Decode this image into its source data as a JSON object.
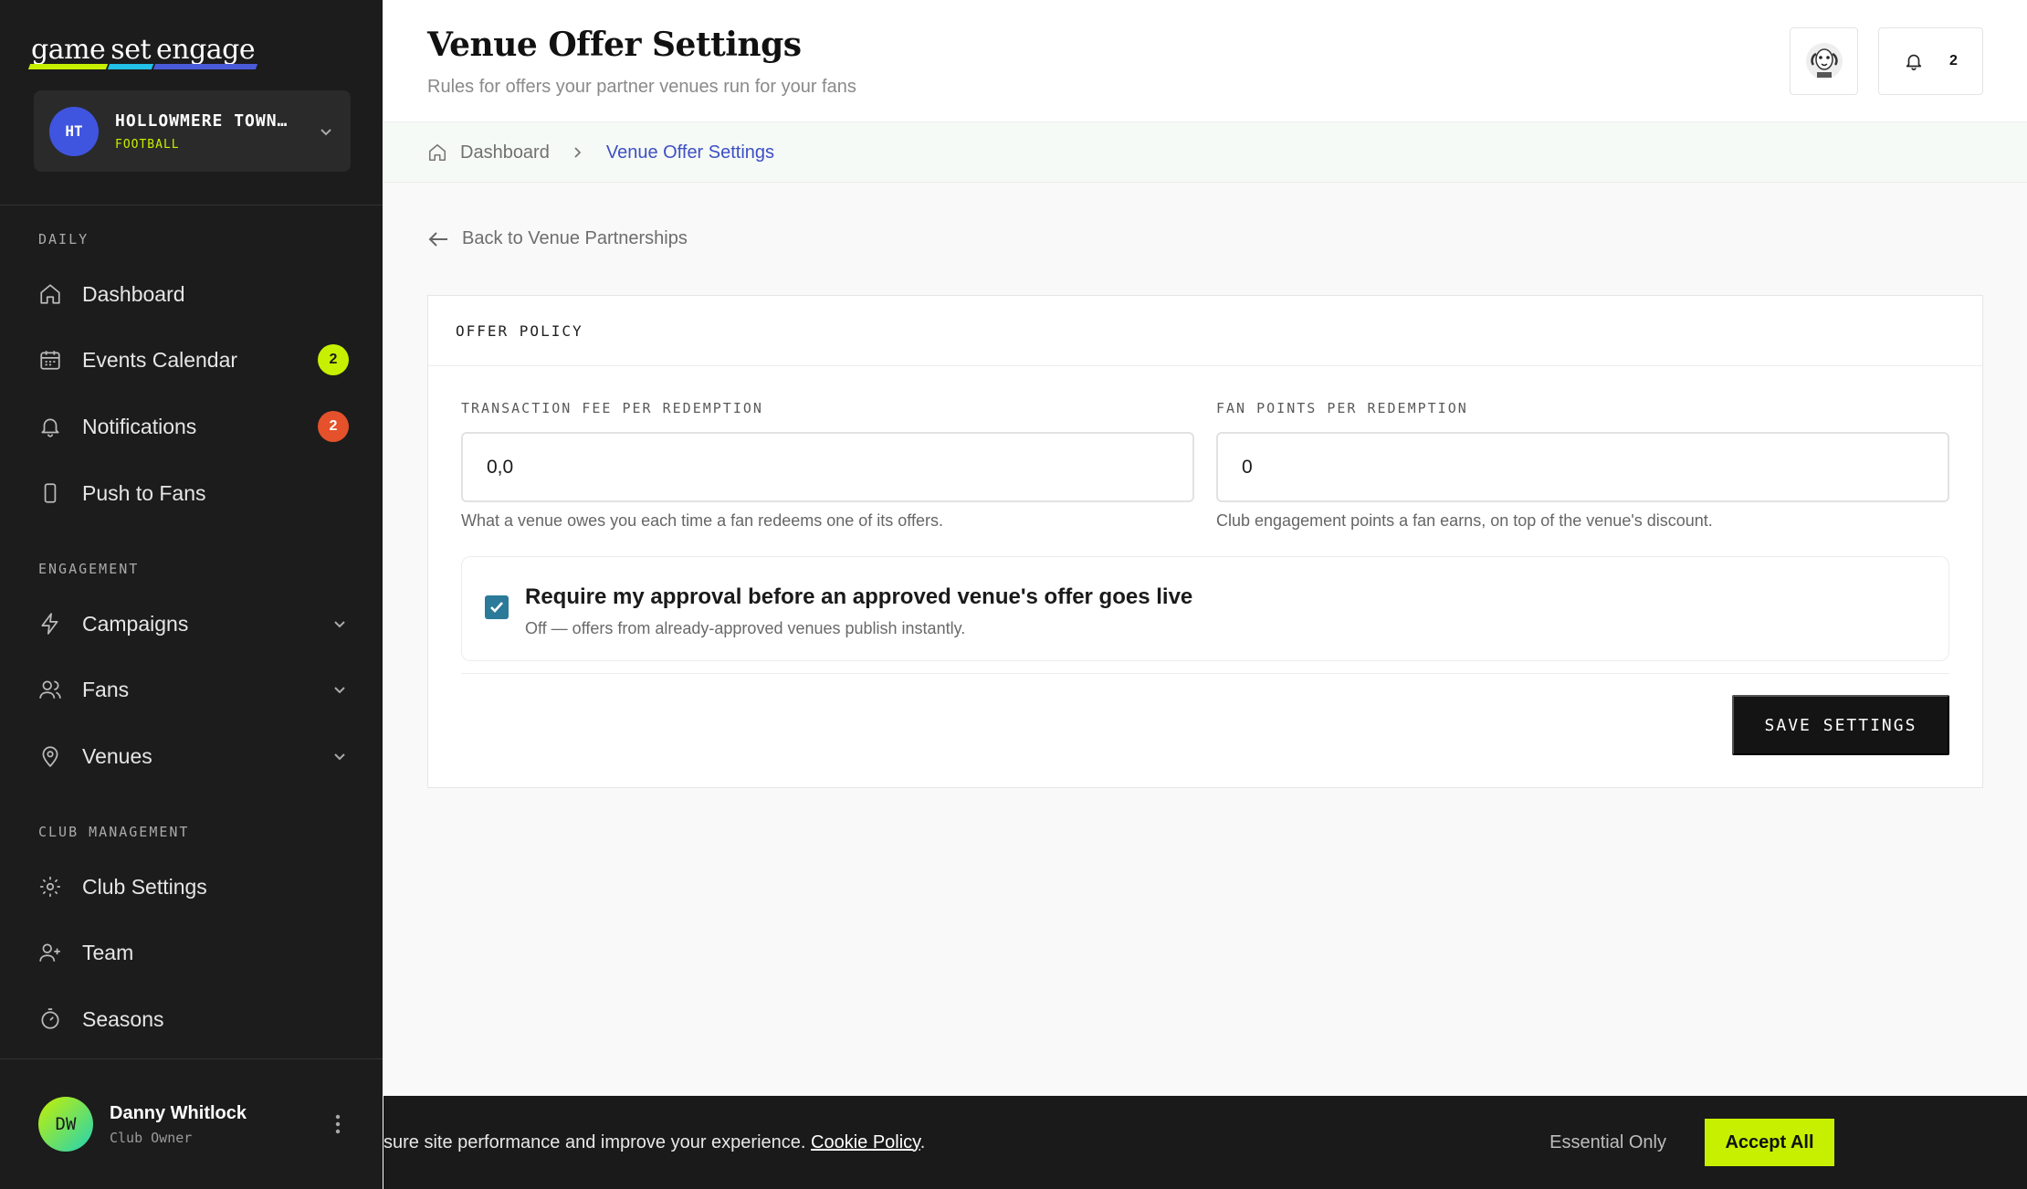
{
  "brand": {
    "logo_words": [
      "game",
      "set",
      "engage"
    ]
  },
  "club": {
    "initials": "HT",
    "name": "HOLLOWMERE TOWN…",
    "sport": "FOOTBALL"
  },
  "sidebar": {
    "sections": [
      "DAILY",
      "ENGAGEMENT",
      "CLUB MANAGEMENT"
    ],
    "items": [
      {
        "label": "Dashboard",
        "icon": "home-icon"
      },
      {
        "label": "Events Calendar",
        "icon": "calendar-icon",
        "badge": "2"
      },
      {
        "label": "Notifications",
        "icon": "bell-icon",
        "badge": "2"
      },
      {
        "label": "Push to Fans",
        "icon": "phone-icon"
      },
      {
        "label": "Campaigns",
        "icon": "lightning-icon"
      },
      {
        "label": "Fans",
        "icon": "users-icon"
      },
      {
        "label": "Venues",
        "icon": "map-pin-icon"
      },
      {
        "label": "Club Settings",
        "icon": "gear-icon"
      },
      {
        "label": "Team",
        "icon": "user-plus-icon"
      },
      {
        "label": "Seasons",
        "icon": "timer-icon"
      }
    ]
  },
  "user": {
    "initials": "DW",
    "name": "Danny Whitlock",
    "role": "Club Owner"
  },
  "header": {
    "title": "Venue Offer Settings",
    "subtitle": "Rules for offers your partner venues run for your fans",
    "notification_count": "2"
  },
  "breadcrumb": {
    "home": "Dashboard",
    "current": "Venue Offer Settings"
  },
  "back_link": "Back to Venue Partnerships",
  "offer_policy": {
    "heading": "OFFER POLICY",
    "fee": {
      "label": "TRANSACTION FEE PER REDEMPTION",
      "value": "0,0",
      "help": "What a venue owes you each time a fan redeems one of its offers."
    },
    "points": {
      "label": "FAN POINTS PER REDEMPTION",
      "value": "0",
      "help": "Club engagement points a fan earns, on top of the venue's discount."
    },
    "approval": {
      "checked": true,
      "title": "Require my approval before an approved venue's offer goes live",
      "description": "Off — offers from already-approved venues publish instantly."
    },
    "save_label": "SAVE SETTINGS"
  },
  "cookie": {
    "text": "sure site performance and improve your experience.",
    "link": "Cookie Policy",
    "after_link": ".",
    "essential_label": "Essential Only",
    "accept_label": "Accept All"
  },
  "colors": {
    "accent_lime": "#c7f000",
    "badge_red": "#e4512a",
    "link_blue": "#3d4fc4",
    "checkbox_teal": "#2b7a9a"
  }
}
